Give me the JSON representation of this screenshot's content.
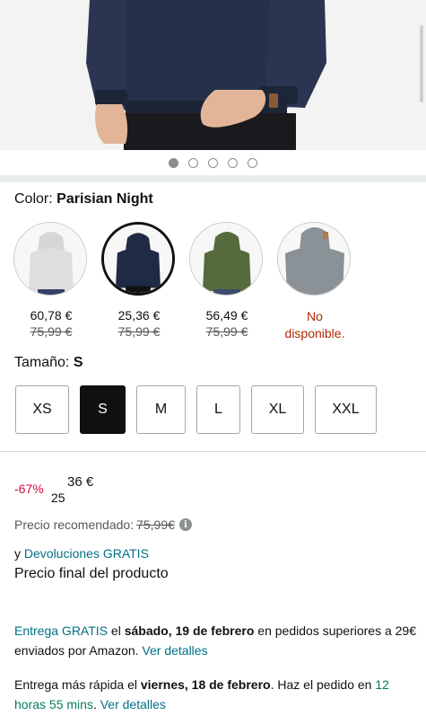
{
  "gallery": {
    "image_alt": "Hombre con sudadera con capucha azul marino",
    "dot_count": 5,
    "active_dot": 0
  },
  "color": {
    "label": "Color:",
    "selected": "Parisian Night"
  },
  "swatches": [
    {
      "name": "Light Grey Heather",
      "price": "60,78 €",
      "list_price": "75,99 €",
      "selected": false,
      "available": true,
      "color": "#dcdcdc"
    },
    {
      "name": "Parisian Night",
      "price": "25,36 €",
      "list_price": "75,99 €",
      "selected": true,
      "available": true,
      "color": "#1f2a44"
    },
    {
      "name": "Olive",
      "price": "56,49 €",
      "list_price": "75,99 €",
      "selected": false,
      "available": true,
      "color": "#556b3e"
    },
    {
      "name": "Grey",
      "unavailable_text": "No disponible.",
      "selected": false,
      "available": false,
      "color": "#8b9297"
    }
  ],
  "size": {
    "label": "Tamaño:",
    "selected": "S",
    "options": [
      "XS",
      "S",
      "M",
      "L",
      "XL",
      "XXL"
    ]
  },
  "price": {
    "discount": "-67%",
    "whole": "25",
    "fraction": "36 €"
  },
  "rrp": {
    "label": "Precio recomendado:",
    "value": "75,99€"
  },
  "returns": {
    "prefix": "y",
    "link": "Devoluciones GRATIS"
  },
  "final_price_text": "Precio final del producto",
  "delivery1": {
    "link": "Entrega GRATIS",
    "text1": " el ",
    "date": "sábado, 19 de febrero",
    "text2": " en pedidos superiores a 29€ enviados por Amazon. ",
    "details": "Ver detalles"
  },
  "delivery2": {
    "text1": "Entrega más rápida el ",
    "date": "viernes, 18 de febrero",
    "text2": ". Haz el pedido en ",
    "countdown": "12 horas 55 mins",
    "text3": ". ",
    "details": "Ver detalles"
  },
  "colors": {
    "link": "#007185",
    "discount": "#cc0c39",
    "unavailable": "#b12704",
    "countdown": "#067d62"
  }
}
